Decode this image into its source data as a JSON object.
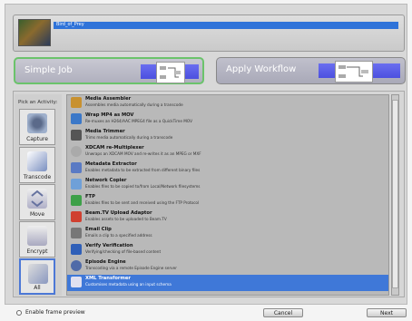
{
  "file_bar": {
    "filename": "Bird_of_Prey"
  },
  "jobs": {
    "simple_job_label": "Simple Job",
    "apply_workflow_label": "Apply Workflow"
  },
  "activity": {
    "pick_label": "Pick an Activity:",
    "categories": [
      {
        "label": "Capture",
        "icon": "camera-icon"
      },
      {
        "label": "Transcode",
        "icon": "transcode-icon"
      },
      {
        "label": "Move",
        "icon": "move-arrows-icon"
      },
      {
        "label": "Encrypt",
        "icon": "encrypt-icon"
      },
      {
        "label": "All",
        "icon": "all-tools-icon"
      }
    ]
  },
  "tools": [
    {
      "title": "Media Assembler",
      "desc": "Assembles media automatically during a transcode",
      "icon": "hammer-icon"
    },
    {
      "title": "Wrap MP4 as MOV",
      "desc": "Re-muxes an H264/AAC MPEG4 file as a QuickTime MOV",
      "icon": "wrap-icon"
    },
    {
      "title": "Media Trimmer",
      "desc": "Trims media automatically during a transcode",
      "icon": "trim-icon"
    },
    {
      "title": "XDCAM re-Multiplexer",
      "desc": "Unwraps an XDCAM MOV and re-writes it as an MPEG or MXF",
      "icon": "remux-icon"
    },
    {
      "title": "Metadata Extractor",
      "desc": "Enables metadata to be extracted from different binary files",
      "icon": "metadata-icon"
    },
    {
      "title": "Network Copier",
      "desc": "Enables files to be copied to/from Local/Network filesystems",
      "icon": "network-icon"
    },
    {
      "title": "FTP",
      "desc": "Enables files to be sent and received using the FTP Protocol",
      "icon": "ftp-icon"
    },
    {
      "title": "Beam.TV Upload Adaptor",
      "desc": "Enables assets to be uploaded to Beam.TV",
      "icon": "beam-icon"
    },
    {
      "title": "Email Clip",
      "desc": "Emails a clip to a specified address",
      "icon": "email-icon"
    },
    {
      "title": "Verify Verification",
      "desc": "Verifying/checking of file-based content",
      "icon": "verify-icon"
    },
    {
      "title": "Episode Engine",
      "desc": "Transcoding via a remote Episode Engine server",
      "icon": "episode-icon"
    },
    {
      "title": "XML Transformer",
      "desc": "Customises metadata using an input schema",
      "icon": "xml-icon"
    }
  ],
  "footer": {
    "enable_label": "Enable frame preview",
    "cancel_label": "Cancel",
    "next_label": "Next"
  },
  "colors": {
    "accent": "#3f78d8",
    "job_bar": "#5a5ee8",
    "selected_border": "#6bc36b"
  }
}
